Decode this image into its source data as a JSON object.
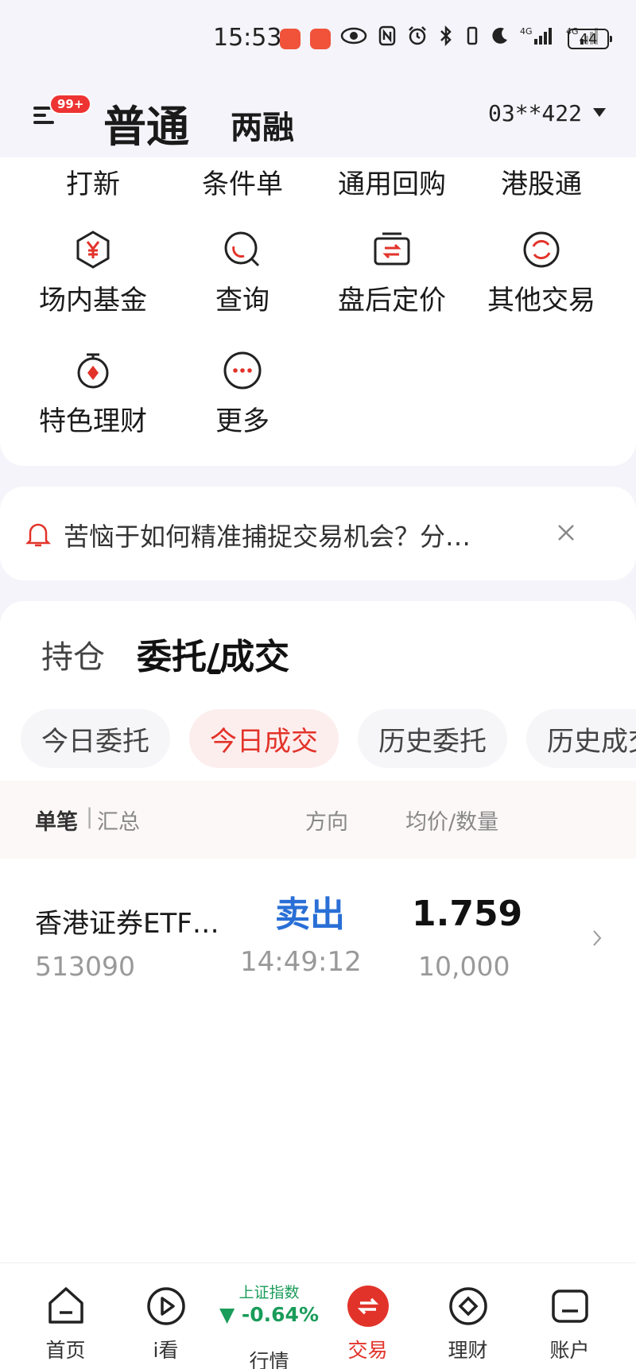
{
  "status_bar": {
    "time": "15:53",
    "battery": "44",
    "network_1": "4G",
    "network_2": "4G"
  },
  "header": {
    "badge": "99+",
    "tab_normal": "普通",
    "tab_margin": "两融",
    "account": "03**422"
  },
  "top_row": [
    "打新",
    "条件单",
    "通用回购",
    "港股通"
  ],
  "grid_items": [
    {
      "label": "场内基金",
      "icon": "yen-hexagon-icon"
    },
    {
      "label": "查询",
      "icon": "search-icon"
    },
    {
      "label": "盘后定价",
      "icon": "exchange-icon"
    },
    {
      "label": "其他交易",
      "icon": "refresh-circle-icon"
    },
    {
      "label": "特色理财",
      "icon": "timer-icon"
    },
    {
      "label": "更多",
      "icon": "more-icon"
    }
  ],
  "notice": {
    "text": "苦恼于如何精准捕捉交易机会？分…"
  },
  "orders": {
    "tab_position": "持仓",
    "tab_orders": "委托/成交",
    "chips": [
      "今日委托",
      "今日成交",
      "历史委托",
      "历史成交"
    ],
    "active_chip": "今日成交",
    "header": {
      "single": "单笔",
      "separator": "|",
      "summary": "汇总",
      "direction": "方向",
      "price_qty": "均价/数量"
    },
    "rows": [
      {
        "name": "香港证券ETF…",
        "code": "513090",
        "direction": "卖出",
        "time": "14:49:12",
        "price": "1.759",
        "quantity": "10,000"
      }
    ]
  },
  "bottom_nav": {
    "items": [
      "首页",
      "i看",
      "行情",
      "交易",
      "理财",
      "账户"
    ],
    "index_title": "上证指数",
    "index_value": "▼ -0.64%",
    "active": "交易"
  },
  "colors": {
    "accent_red": "#e2332a",
    "sell_blue": "#2a6fd6",
    "down_green": "#1a9c5a"
  }
}
